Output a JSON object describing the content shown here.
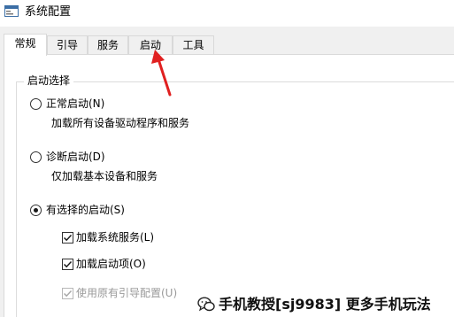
{
  "window": {
    "title": "系统配置"
  },
  "tabs": [
    {
      "label": "常规",
      "active": true
    },
    {
      "label": "引导",
      "active": false
    },
    {
      "label": "服务",
      "active": false
    },
    {
      "label": "启动",
      "active": false
    },
    {
      "label": "工具",
      "active": false
    }
  ],
  "startup_selection": {
    "legend": "启动选择",
    "normal": {
      "label": "正常启动(N)",
      "description": "加载所有设备驱动程序和服务",
      "selected": false
    },
    "diagnostic": {
      "label": "诊断启动(D)",
      "description": "仅加载基本设备和服务",
      "selected": false
    },
    "selective": {
      "label": "有选择的启动(S)",
      "selected": true
    },
    "options": [
      {
        "label": "加载系统服务(L)",
        "checked": true,
        "enabled": true
      },
      {
        "label": "加载启动项(O)",
        "checked": true,
        "enabled": true
      },
      {
        "label": "使用原有引导配置(U)",
        "checked": true,
        "enabled": false
      }
    ]
  },
  "annotation": {
    "arrow_color": "#e02020"
  },
  "watermark": {
    "icon": "wechat-icon",
    "text": "手机教授[sj9983] 更多手机玩法"
  }
}
